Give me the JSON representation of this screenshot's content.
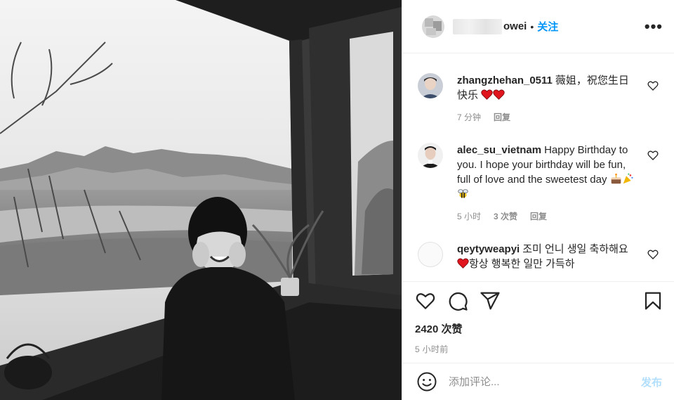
{
  "post": {
    "author_visible_suffix": "owei",
    "separator": "•",
    "follow_label": "关注",
    "more_label": "•••"
  },
  "comments": [
    {
      "user": "zhangzhehan_0511",
      "text": "薇姐，祝您生日快乐",
      "emojis": [
        "red-heart",
        "red-heart"
      ],
      "time": "7 分钟",
      "likes": "",
      "reply_label": "回复"
    },
    {
      "user": "alec_su_vietnam",
      "text": "Happy Birthday to you. I hope your birthday will be fun, full of love and the sweetest day",
      "emojis": [
        "birthday-cake",
        "party-popper",
        "bee"
      ],
      "time": "5 小时",
      "likes": "3 次赞",
      "reply_label": "回复"
    },
    {
      "user": "qeytyweapyi",
      "text_before_heart": "조미 언니 생일 축하해요",
      "text_after_heart": "항상 행복한 일만 가득하",
      "time": "",
      "likes": "",
      "reply_label": ""
    }
  ],
  "actions": {
    "likes_count": "2420 次赞",
    "posted_ago": "5 小时前"
  },
  "add_comment": {
    "placeholder": "添加评论...",
    "post_label": "发布"
  },
  "colors": {
    "accent_blue": "#0095f6",
    "post_disabled": "#b2dffc",
    "heart_red": "#ed1c24",
    "muted_text": "#8e8e8e"
  },
  "icons": [
    "heart-icon",
    "comment-icon",
    "share-icon",
    "bookmark-icon",
    "smile-icon",
    "more-options-icon",
    "like-comment-icon"
  ]
}
